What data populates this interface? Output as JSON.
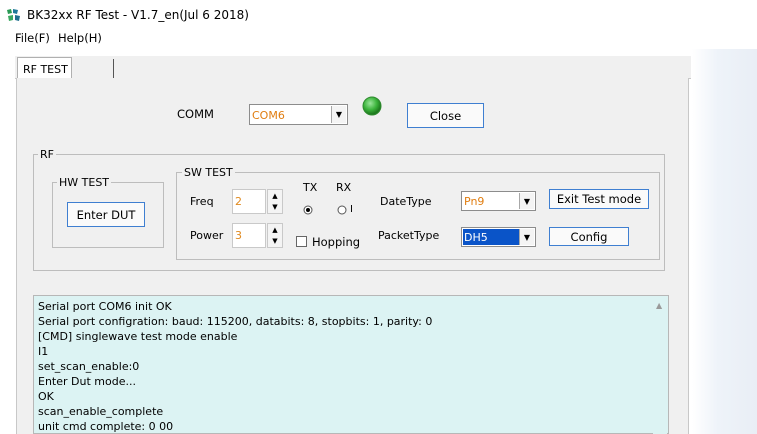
{
  "window": {
    "title": "BK32xx RF Test - V1.7_en(Jul  6 2018)"
  },
  "menu": [
    {
      "label": "File(F)"
    },
    {
      "label": "Help(H)"
    }
  ],
  "tabs": [
    {
      "label": "RF TEST"
    },
    {
      "label": ""
    }
  ],
  "comm": {
    "label": "COMM",
    "port": "COM6",
    "status_color": "#3cb43c",
    "close_label": "Close"
  },
  "rf": {
    "title": "RF",
    "hw_test": {
      "title": "HW TEST",
      "enter_dut_label": "Enter DUT"
    },
    "sw_test": {
      "title": "SW TEST",
      "freq_label": "Freq",
      "freq_value": "2",
      "power_label": "Power",
      "power_value": "3",
      "tx_label": "TX",
      "rx_label": "RX",
      "tx_radio_text": "",
      "rx_radio_text": "I",
      "hopping_label": "Hopping",
      "datetype_label": "DateType",
      "datetype_value": "Pn9",
      "packettype_label": "PacketType",
      "packettype_value": "DH5",
      "exit_test_label": "Exit Test mode",
      "config_label": "Config"
    }
  },
  "log": {
    "lines": [
      "Serial port COM6 init OK",
      "Serial port configration: baud: 115200, databits: 8, stopbits: 1, parity: 0",
      "[CMD] singlewave test mode enable",
      "I1",
      "set_scan_enable:0",
      "Enter Dut mode...",
      "OK",
      "scan_enable_complete",
      "unit cmd complete: 0 00"
    ]
  }
}
